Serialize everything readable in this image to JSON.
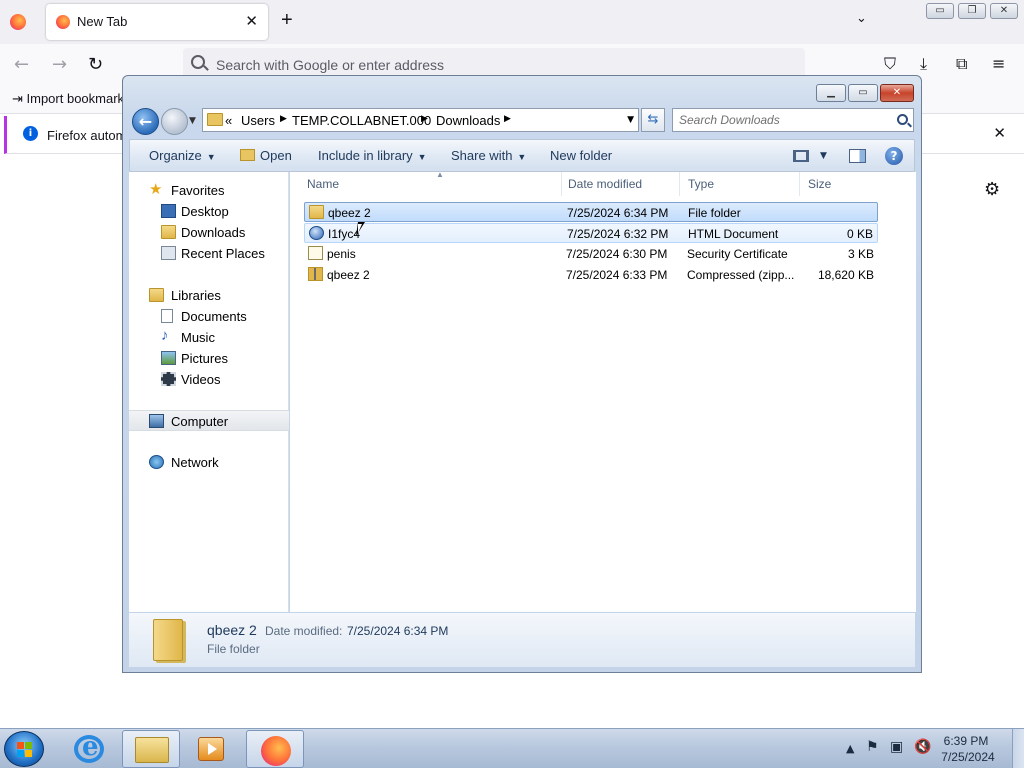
{
  "browser": {
    "tab_title": "New Tab",
    "tab_close_glyph": "✕",
    "new_tab_glyph": "+",
    "list_tabs_glyph": "⌄",
    "url_placeholder": "Search with Google or enter address",
    "bookmark_import": "Import bookmark",
    "notice_text": "Firefox automa",
    "notice_close_glyph": "✕"
  },
  "explorer": {
    "breadcrumb": {
      "prefix": "«",
      "parts": [
        "Users",
        "TEMP.COLLABNET.000",
        "Downloads"
      ]
    },
    "search_placeholder": "Search Downloads",
    "commands": {
      "organize": "Organize",
      "open": "Open",
      "include": "Include in library",
      "share": "Share with",
      "new_folder": "New folder"
    },
    "nav": {
      "favorites": "Favorites",
      "desktop": "Desktop",
      "downloads": "Downloads",
      "recent": "Recent Places",
      "libraries": "Libraries",
      "documents": "Documents",
      "music": "Music",
      "pictures": "Pictures",
      "videos": "Videos",
      "computer": "Computer",
      "network": "Network"
    },
    "columns": {
      "name": "Name",
      "date": "Date modified",
      "type": "Type",
      "size": "Size"
    },
    "files": [
      {
        "name": "qbeez 2",
        "date": "7/25/2024 6:34 PM",
        "type": "File folder",
        "size": "",
        "icon": "folder-icon"
      },
      {
        "name": "I1fyc4",
        "date": "7/25/2024 6:32 PM",
        "type": "HTML Document",
        "size": "0 KB",
        "icon": "html-document-icon"
      },
      {
        "name": "penis",
        "date": "7/25/2024 6:30 PM",
        "type": "Security Certificate",
        "size": "3 KB",
        "icon": "certificate-icon"
      },
      {
        "name": "qbeez 2",
        "date": "7/25/2024 6:33 PM",
        "type": "Compressed (zipp...",
        "size": "18,620 KB",
        "icon": "zip-folder-icon"
      }
    ],
    "details": {
      "name": "qbeez 2",
      "date_label": "Date modified:",
      "date_value": "7/25/2024 6:34 PM",
      "type": "File folder"
    }
  },
  "taskbar": {
    "time": "6:39 PM",
    "date": "7/25/2024"
  }
}
